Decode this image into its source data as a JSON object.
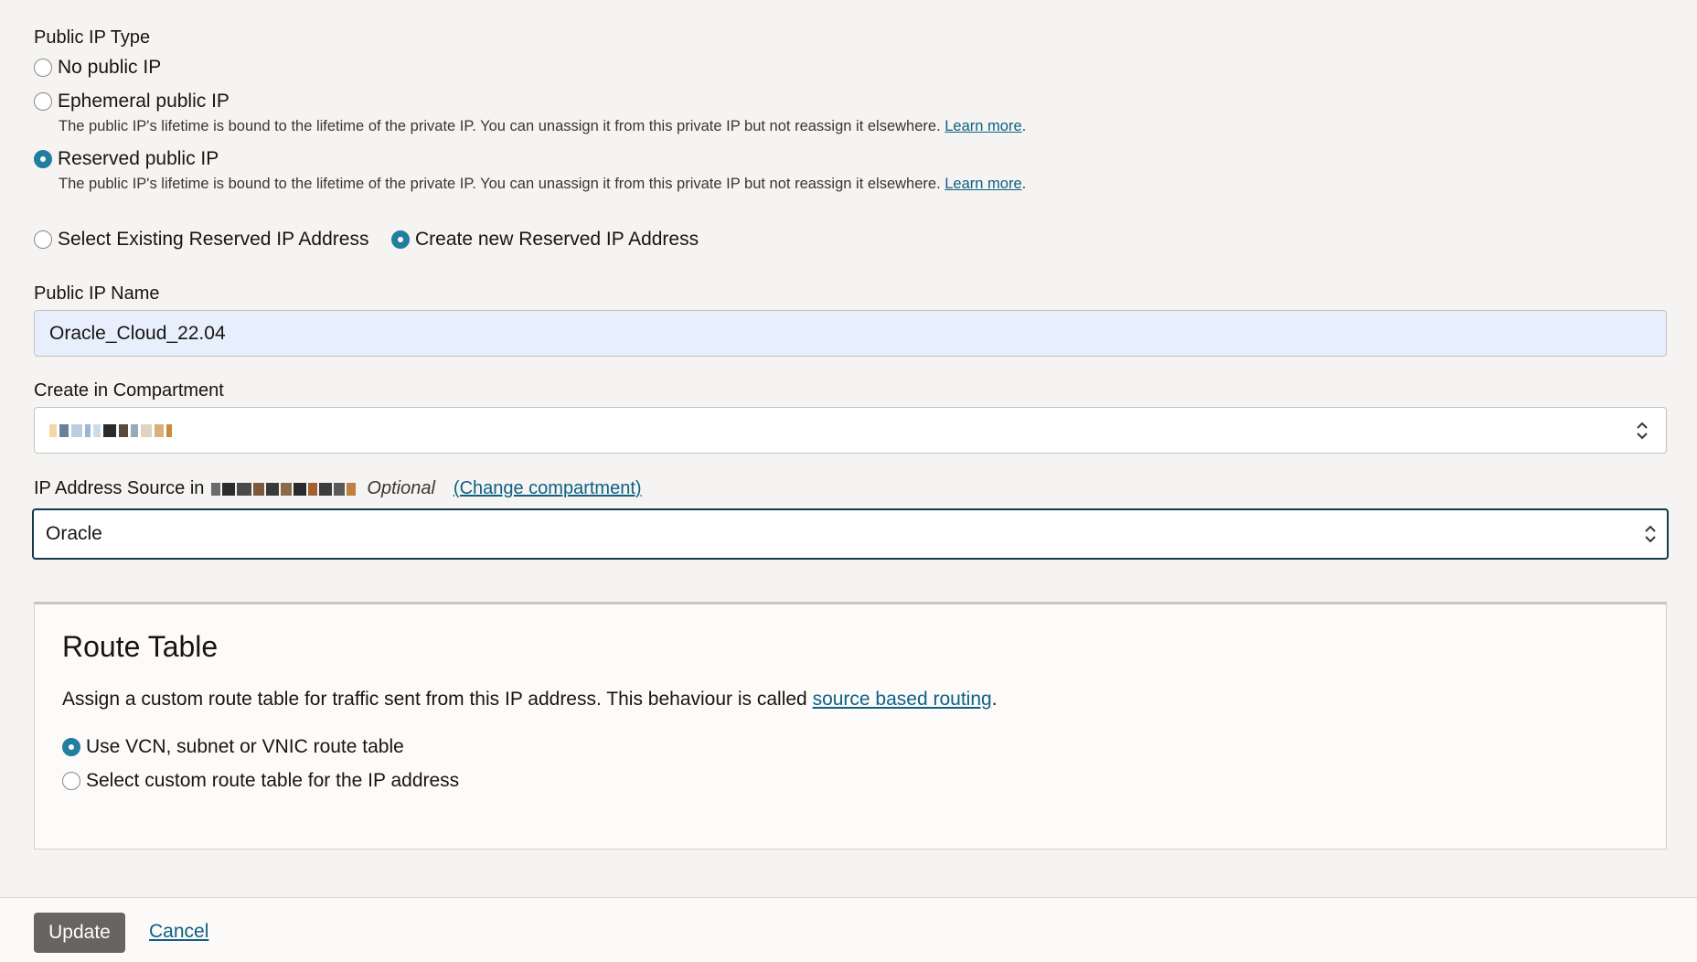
{
  "public_ip_type": {
    "label": "Public IP Type",
    "options": [
      {
        "label": "No public IP",
        "selected": false
      },
      {
        "label": "Ephemeral public IP",
        "selected": false,
        "description": "The public IP's lifetime is bound to the lifetime of the private IP. You can unassign it from this private IP but not reassign it elsewhere.",
        "link": "Learn more"
      },
      {
        "label": "Reserved public IP",
        "selected": true,
        "description": "The public IP's lifetime is bound to the lifetime of the private IP. You can unassign it from this private IP but not reassign it elsewhere.",
        "link": "Learn more"
      }
    ]
  },
  "reserved_ip_mode": {
    "options": [
      {
        "label": "Select Existing Reserved IP Address",
        "selected": false
      },
      {
        "label": "Create new Reserved IP Address",
        "selected": true
      }
    ]
  },
  "public_ip_name": {
    "label": "Public IP Name",
    "value": "Oracle_Cloud_22.04"
  },
  "compartment": {
    "label": "Create in Compartment",
    "value_redacted": true
  },
  "ip_source": {
    "label_prefix": "IP Address Source in",
    "optional": "Optional",
    "change_link": "(Change compartment)",
    "value": "Oracle"
  },
  "route_table": {
    "title": "Route Table",
    "description_prefix": "Assign a custom route table for traffic sent from this IP address. This behaviour is called ",
    "description_link": "source based routing",
    "description_suffix": ".",
    "options": [
      {
        "label": "Use VCN, subnet or VNIC route table",
        "selected": true
      },
      {
        "label": "Select custom route table for the IP address",
        "selected": false
      }
    ]
  },
  "footer": {
    "update_label": "Update",
    "cancel_label": "Cancel"
  },
  "colors": {
    "accent": "#227e9e",
    "link": "#0f6083",
    "primary_button": "#686461",
    "focus_border": "#13394f",
    "input_highlight": "#e8effc"
  }
}
